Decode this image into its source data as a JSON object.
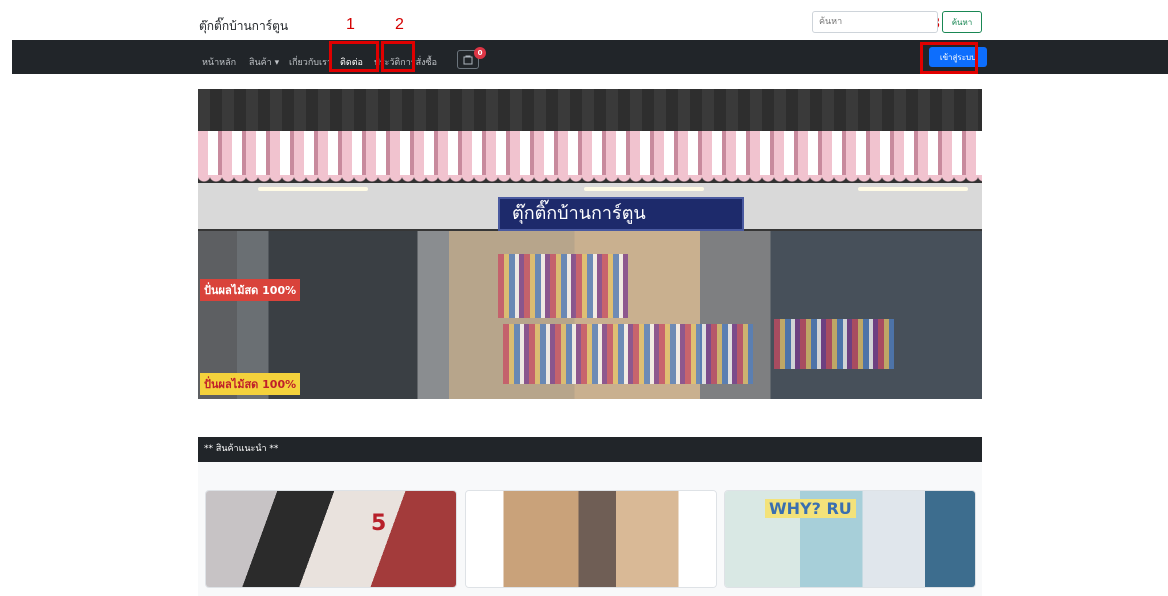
{
  "header": {
    "brand": "ตุ๊กติ๊กบ้านการ์ตูน",
    "search_placeholder": "ค้นหา",
    "search_button": "ค้นหา"
  },
  "annotations": [
    "1",
    "2",
    "3"
  ],
  "nav": {
    "items": [
      {
        "label": "หน้าหลัก"
      },
      {
        "label": "สินค้า ▾"
      },
      {
        "label": "เกี่ยวกับเรา"
      },
      {
        "label": "ติดต่อ"
      },
      {
        "label": "ประวัติการสั่งซื้อ"
      }
    ],
    "cart_count": "0",
    "login_button": "เข้าสู่ระบบ"
  },
  "hero": {
    "sign_text": "ตุ๊กติ๊กบ้านการ์ตูน",
    "poster_top": "ปั่นผลไม้สด 100%",
    "poster_bottom": "ปั่นผลไม้สด 100%"
  },
  "recommended": {
    "title": "** สินค้าแนะนำ **",
    "cards": [
      {
        "tag": "5"
      },
      {
        "tag": ""
      },
      {
        "tag": "WHY? RU"
      }
    ]
  },
  "colors": {
    "navbar": "#212529",
    "login": "#0d6efd",
    "search_btn": "#198754",
    "annotation": "#e00000",
    "badge": "#dc3545"
  }
}
